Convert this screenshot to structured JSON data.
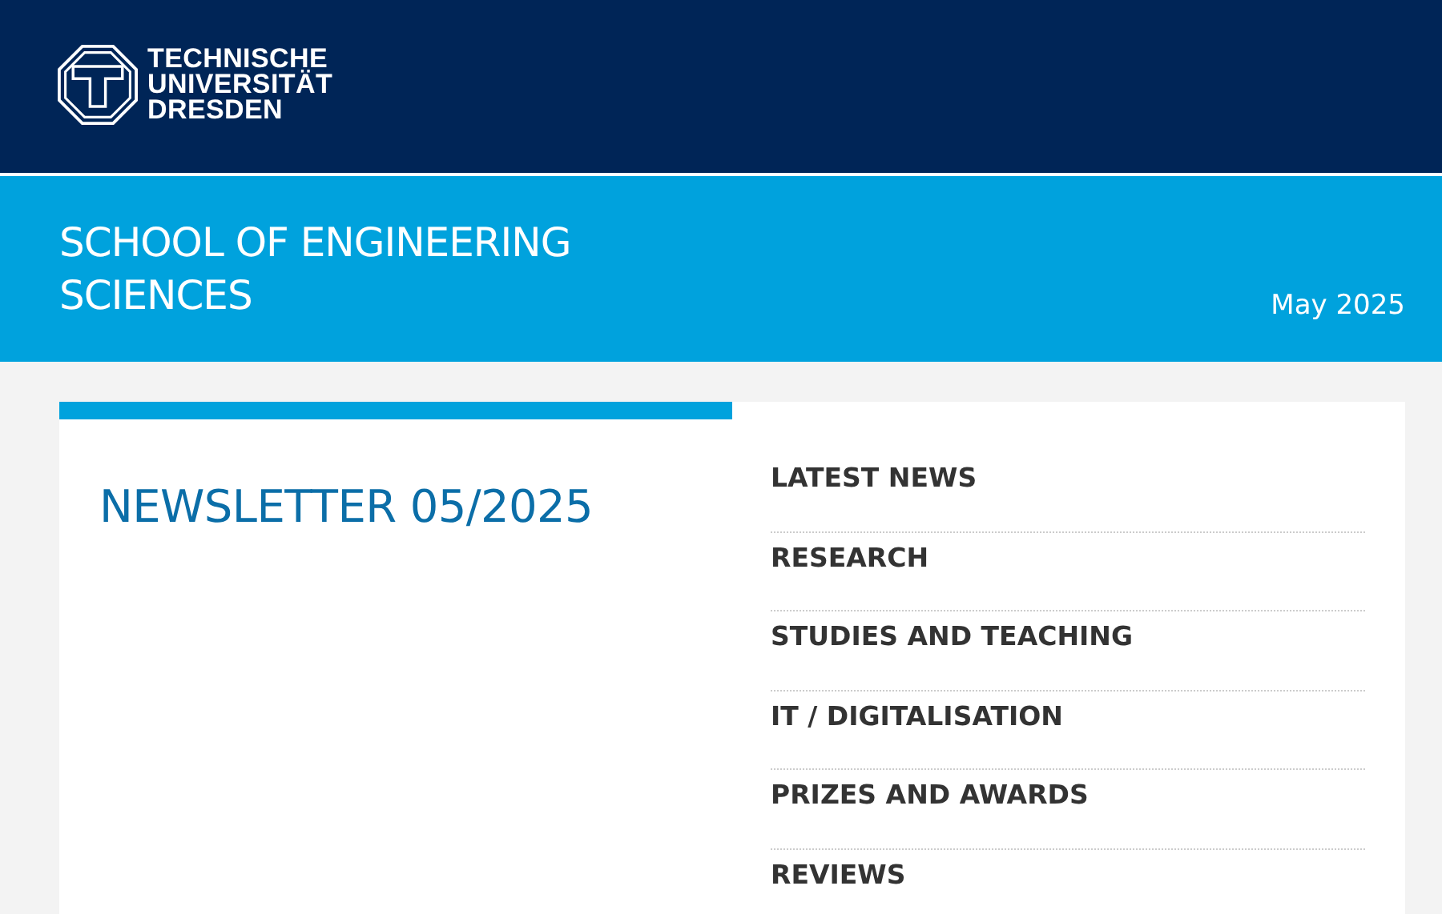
{
  "logo": {
    "lines": [
      "TECHNISCHE",
      "UNIVERSITÄT",
      "DRESDEN"
    ]
  },
  "banner": {
    "title": "SCHOOL OF ENGINEERING SCIENCES",
    "date": "May 2025"
  },
  "newsletter": {
    "title": "NEWSLETTER 05/2025"
  },
  "menu": [
    {
      "label": "LATEST NEWS"
    },
    {
      "label": "RESEARCH"
    },
    {
      "label": "STUDIES AND TEACHING"
    },
    {
      "label": "IT / DIGITALISATION"
    },
    {
      "label": "PRIZES AND AWARDS"
    },
    {
      "label": "REVIEWS"
    }
  ]
}
